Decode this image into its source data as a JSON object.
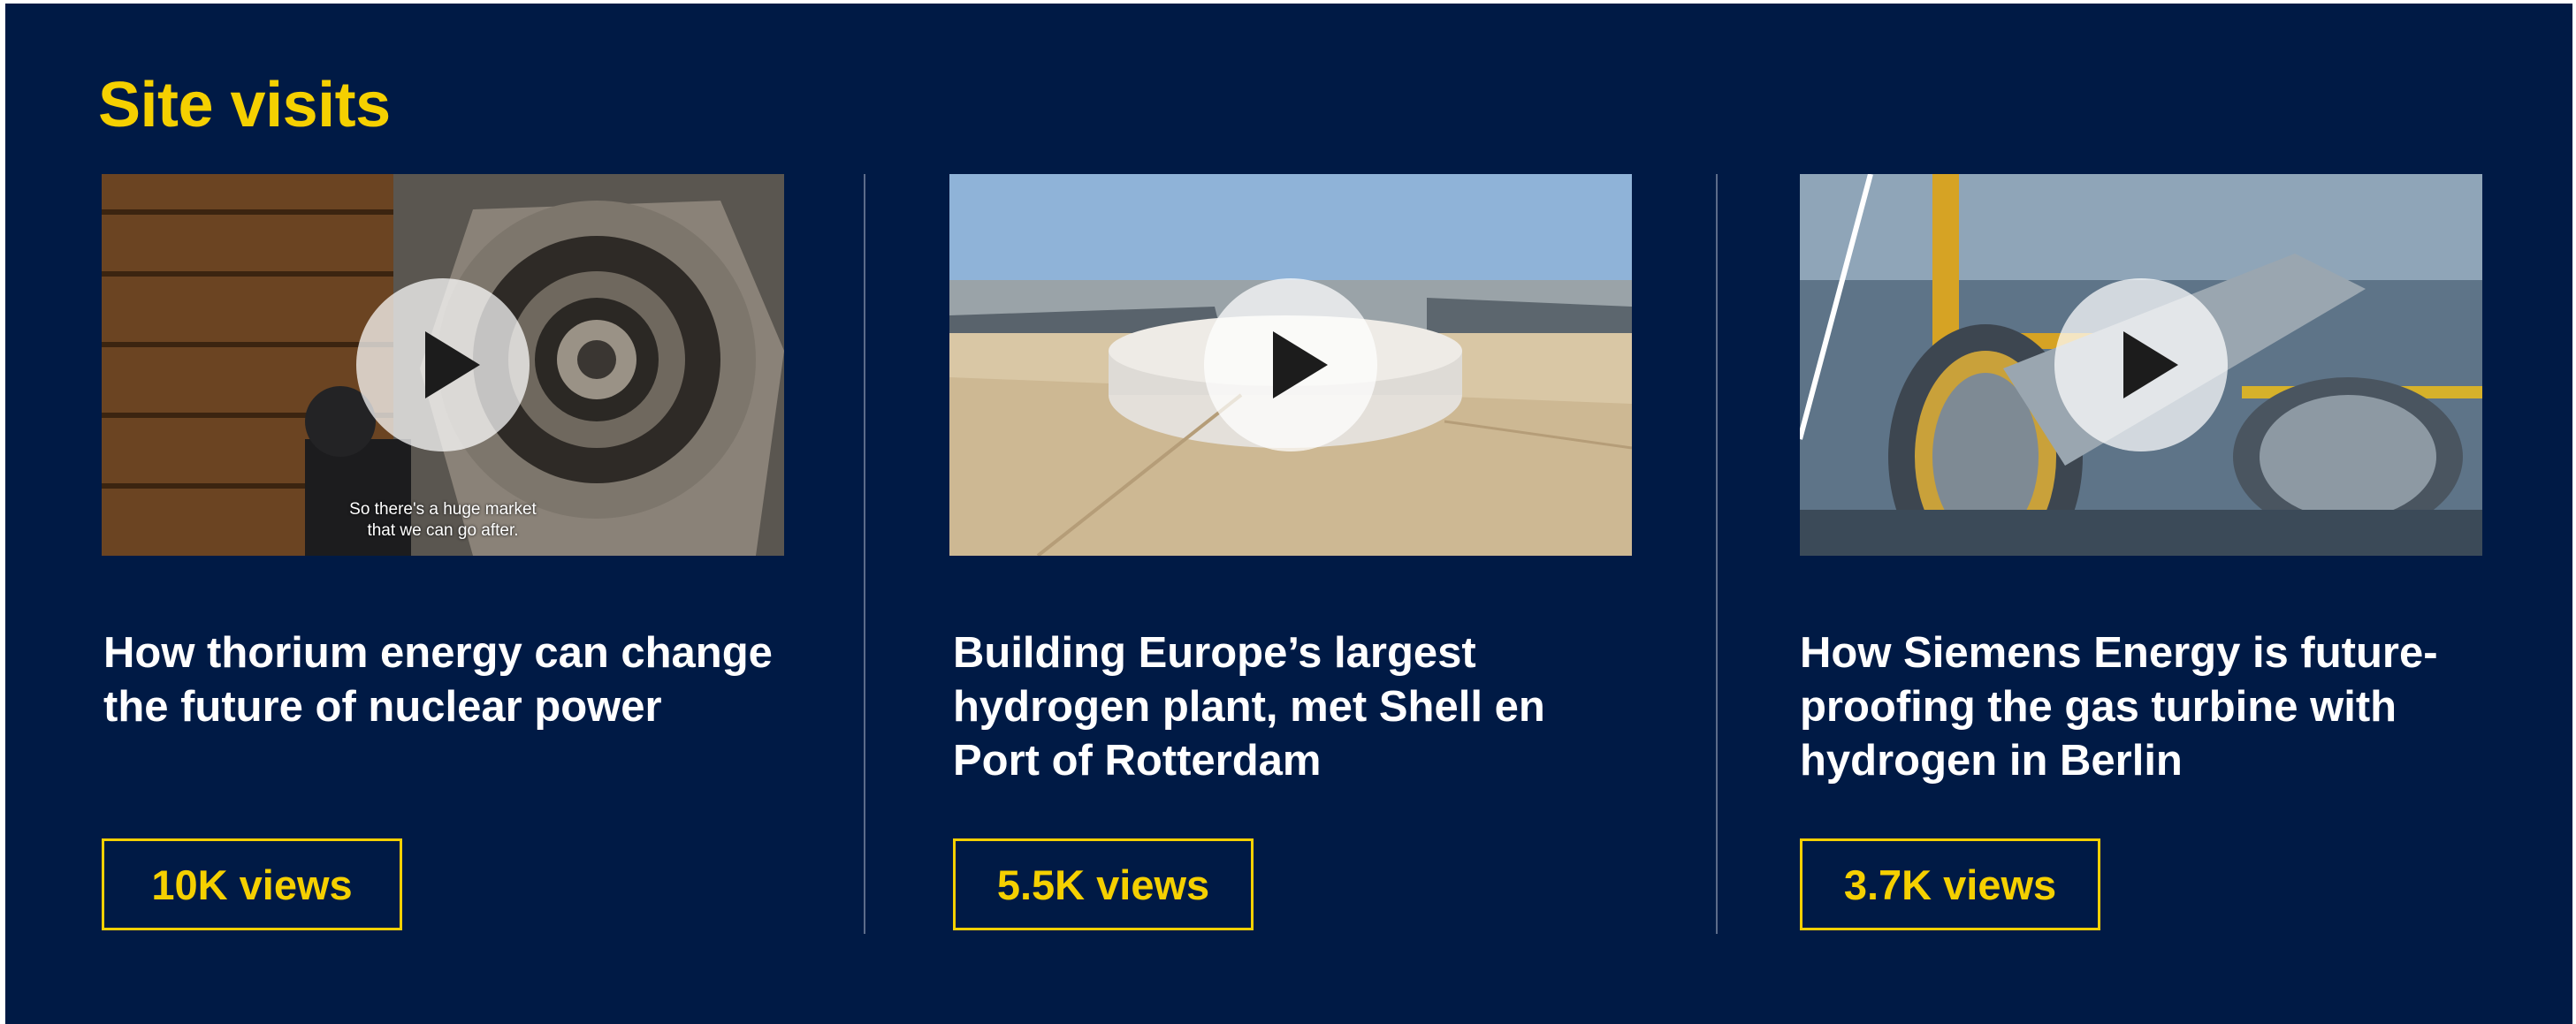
{
  "section": {
    "title": "Site visits"
  },
  "colors": {
    "background": "#001a45",
    "accent": "#f5d000",
    "title_text": "#ffffff",
    "divider": "#5c6c8a"
  },
  "videos": [
    {
      "title": "How thorium energy can change the future of nuclear power",
      "views": "10K views",
      "thumbnail_subtitle": "So there's a huge market\nthat we can go after.",
      "icon": "play-icon"
    },
    {
      "title": "Building Europe’s largest hydrogen plant, met Shell en Port of Rotterdam",
      "views": "5.5K views",
      "icon": "play-icon"
    },
    {
      "title": "How Siemens Energy is future-proofing the gas turbine with hydrogen in Berlin",
      "views": "3.7K views",
      "icon": "play-icon"
    }
  ]
}
